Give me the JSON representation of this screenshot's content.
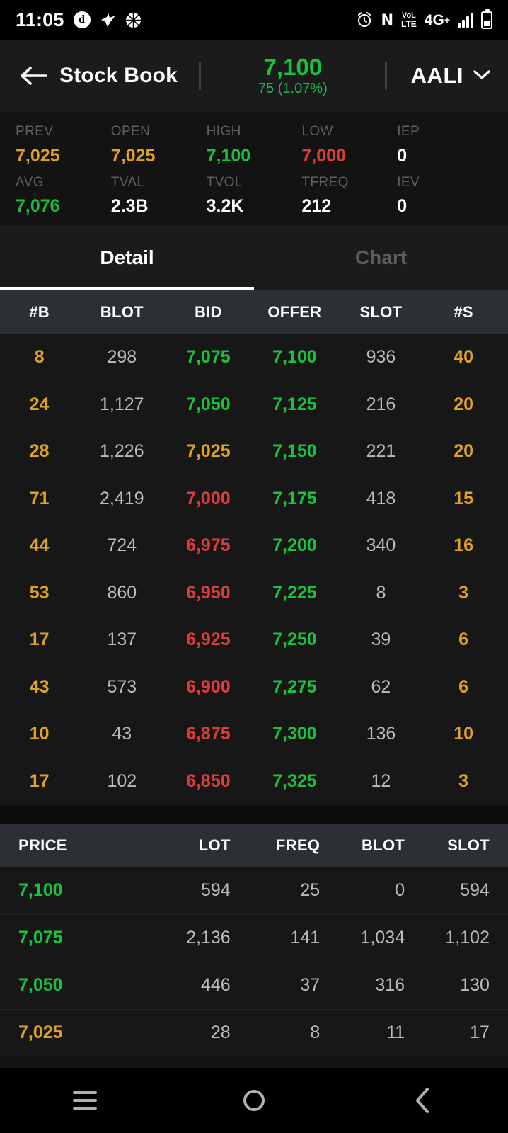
{
  "status_bar": {
    "time": "11:05",
    "left_icons": [
      "dana-app-icon",
      "bird-app-icon",
      "basketball-app-icon"
    ],
    "right_icons": [
      "alarm-icon",
      "nfc-icon",
      "volte-icon",
      "network-4gplus-icon",
      "signal-bars-icon",
      "battery-icon"
    ],
    "volte_top": "VoL",
    "volte_bottom": "LTE",
    "network": "4G",
    "network_plus": "+",
    "nfc_glyph": "N",
    "alarm_glyph": "⏰",
    "bird_glyph": "🕊",
    "ball_glyph": "🏀",
    "dana_glyph": "d"
  },
  "header": {
    "back_icon": "back-arrow-icon",
    "title": "Stock Book",
    "last_price": "7,100",
    "change": "75 (1.07%)",
    "change_color": "#1db954",
    "price_color": "#18c23e",
    "ticker": "AALI",
    "dropdown_icon": "chevron-down-icon"
  },
  "stats": {
    "row1": [
      {
        "label": "PREV",
        "value": "7,025",
        "color": "#e0a220"
      },
      {
        "label": "OPEN",
        "value": "7,025",
        "color": "#e0a220"
      },
      {
        "label": "HIGH",
        "value": "7,100",
        "color": "#18c23e"
      },
      {
        "label": "LOW",
        "value": "7,000",
        "color": "#e03b3b"
      },
      {
        "label": "IEP",
        "value": "0",
        "color": "#ffffff"
      }
    ],
    "row2": [
      {
        "label": "AVG",
        "value": "7,076",
        "color": "#18c23e"
      },
      {
        "label": "TVAL",
        "value": "2.3B",
        "color": "#ffffff"
      },
      {
        "label": "TVOL",
        "value": "3.2K",
        "color": "#ffffff"
      },
      {
        "label": "TFREQ",
        "value": "212",
        "color": "#ffffff"
      },
      {
        "label": "IEV",
        "value": "0",
        "color": "#ffffff"
      }
    ]
  },
  "tabs": [
    {
      "label": "Detail",
      "active": true
    },
    {
      "label": "Chart",
      "active": false
    }
  ],
  "orderbook": {
    "headers": [
      "#B",
      "BLOT",
      "BID",
      "OFFER",
      "SLOT",
      "#S"
    ],
    "rows": [
      {
        "nb": "8",
        "blot": "298",
        "bid": "7,075",
        "bid_color": "#18c23e",
        "offer": "7,100",
        "slot": "936",
        "ns": "40"
      },
      {
        "nb": "24",
        "blot": "1,127",
        "bid": "7,050",
        "bid_color": "#18c23e",
        "offer": "7,125",
        "slot": "216",
        "ns": "20"
      },
      {
        "nb": "28",
        "blot": "1,226",
        "bid": "7,025",
        "bid_color": "#e0a220",
        "offer": "7,150",
        "slot": "221",
        "ns": "20"
      },
      {
        "nb": "71",
        "blot": "2,419",
        "bid": "7,000",
        "bid_color": "#e03b3b",
        "offer": "7,175",
        "slot": "418",
        "ns": "15"
      },
      {
        "nb": "44",
        "blot": "724",
        "bid": "6,975",
        "bid_color": "#e03b3b",
        "offer": "7,200",
        "slot": "340",
        "ns": "16"
      },
      {
        "nb": "53",
        "blot": "860",
        "bid": "6,950",
        "bid_color": "#e03b3b",
        "offer": "7,225",
        "slot": "8",
        "ns": "3"
      },
      {
        "nb": "17",
        "blot": "137",
        "bid": "6,925",
        "bid_color": "#e03b3b",
        "offer": "7,250",
        "slot": "39",
        "ns": "6"
      },
      {
        "nb": "43",
        "blot": "573",
        "bid": "6,900",
        "bid_color": "#e03b3b",
        "offer": "7,275",
        "slot": "62",
        "ns": "6"
      },
      {
        "nb": "10",
        "blot": "43",
        "bid": "6,875",
        "bid_color": "#e03b3b",
        "offer": "7,300",
        "slot": "136",
        "ns": "10"
      },
      {
        "nb": "17",
        "blot": "102",
        "bid": "6,850",
        "bid_color": "#e03b3b",
        "offer": "7,325",
        "slot": "12",
        "ns": "3"
      }
    ],
    "nb_color": "#e0a220",
    "ns_color": "#e0a220",
    "offer_color": "#18c23e"
  },
  "summary": {
    "headers": [
      "PRICE",
      "LOT",
      "FREQ",
      "BLOT",
      "SLOT"
    ],
    "rows": [
      {
        "price": "7,100",
        "price_color": "#18c23e",
        "lot": "594",
        "freq": "25",
        "blot": "0",
        "slot": "594"
      },
      {
        "price": "7,075",
        "price_color": "#18c23e",
        "lot": "2,136",
        "freq": "141",
        "blot": "1,034",
        "slot": "1,102"
      },
      {
        "price": "7,050",
        "price_color": "#18c23e",
        "lot": "446",
        "freq": "37",
        "blot": "316",
        "slot": "130"
      },
      {
        "price": "7,025",
        "price_color": "#e0a220",
        "lot": "28",
        "freq": "8",
        "blot": "11",
        "slot": "17"
      }
    ]
  },
  "navbar": {
    "items": [
      "menu-recents-icon",
      "home-circle-icon",
      "back-chevron-icon"
    ]
  }
}
